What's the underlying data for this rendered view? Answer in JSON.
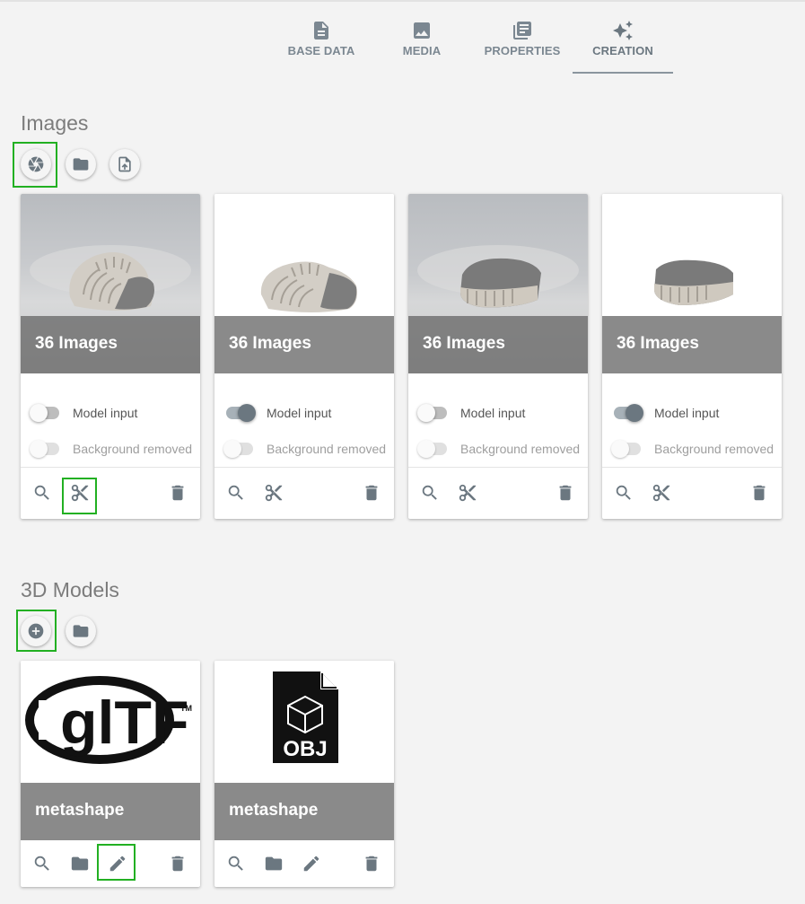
{
  "tabs": [
    {
      "label": "BASE DATA",
      "icon": "document-icon"
    },
    {
      "label": "MEDIA",
      "icon": "image-icon"
    },
    {
      "label": "PROPERTIES",
      "icon": "library-books-icon"
    },
    {
      "label": "CREATION",
      "icon": "sparkle-icon",
      "active": true
    }
  ],
  "images_section": {
    "title": "Images",
    "tools": [
      "camera-aperture-icon",
      "folder-icon",
      "upload-file-icon"
    ],
    "cards": [
      {
        "caption": "36 Images",
        "model_input_label": "Model input",
        "model_input": false,
        "bg_removed_label": "Background removed",
        "bg_removed": false,
        "background": "grey"
      },
      {
        "caption": "36 Images",
        "model_input_label": "Model input",
        "model_input": true,
        "bg_removed_label": "Background removed",
        "bg_removed": false,
        "background": "white"
      },
      {
        "caption": "36 Images",
        "model_input_label": "Model input",
        "model_input": false,
        "bg_removed_label": "Background removed",
        "bg_removed": false,
        "background": "grey"
      },
      {
        "caption": "36 Images",
        "model_input_label": "Model input",
        "model_input": true,
        "bg_removed_label": "Background removed",
        "bg_removed": false,
        "background": "white"
      }
    ]
  },
  "models_section": {
    "title": "3D Models",
    "tools": [
      "add-circle-icon",
      "folder-icon"
    ],
    "cards": [
      {
        "caption": "metashape",
        "logo": "gltf-logo",
        "logo_text": "glTF"
      },
      {
        "caption": "metashape",
        "logo": "obj-file-logo",
        "logo_text": "OBJ"
      }
    ]
  },
  "colors": {
    "highlight": "#22b022",
    "icon": "#6b7780",
    "background": "#f3f3f3"
  }
}
